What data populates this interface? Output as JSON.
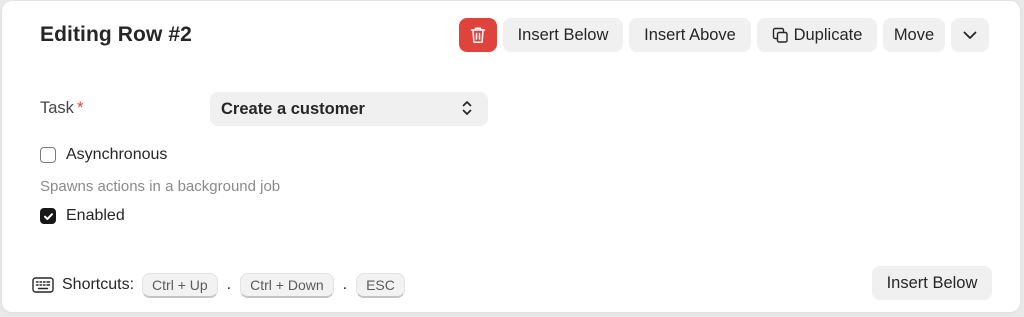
{
  "header": {
    "title": "Editing Row #2",
    "buttons": {
      "delete_icon": "trash-icon",
      "insert_below": "Insert Below",
      "insert_above": "Insert Above",
      "duplicate": "Duplicate",
      "duplicate_icon": "copy-icon",
      "move": "Move",
      "more_icon": "chevron-down-icon"
    }
  },
  "form": {
    "task": {
      "label": "Task",
      "required_mark": "*",
      "value": "Create a customer"
    },
    "asynchronous": {
      "label": "Asynchronous",
      "checked": false,
      "description": "Spawns actions in a background job"
    },
    "enabled": {
      "label": "Enabled",
      "checked": true
    }
  },
  "footer": {
    "shortcuts_label": "Shortcuts:",
    "keys": [
      "Ctrl + Up",
      "Ctrl + Down",
      "ESC"
    ],
    "separator": ".",
    "insert_below": "Insert Below"
  },
  "colors": {
    "danger": "#e0433b",
    "button_bg": "#f0f0f0",
    "checkbox_on": "#171717"
  }
}
